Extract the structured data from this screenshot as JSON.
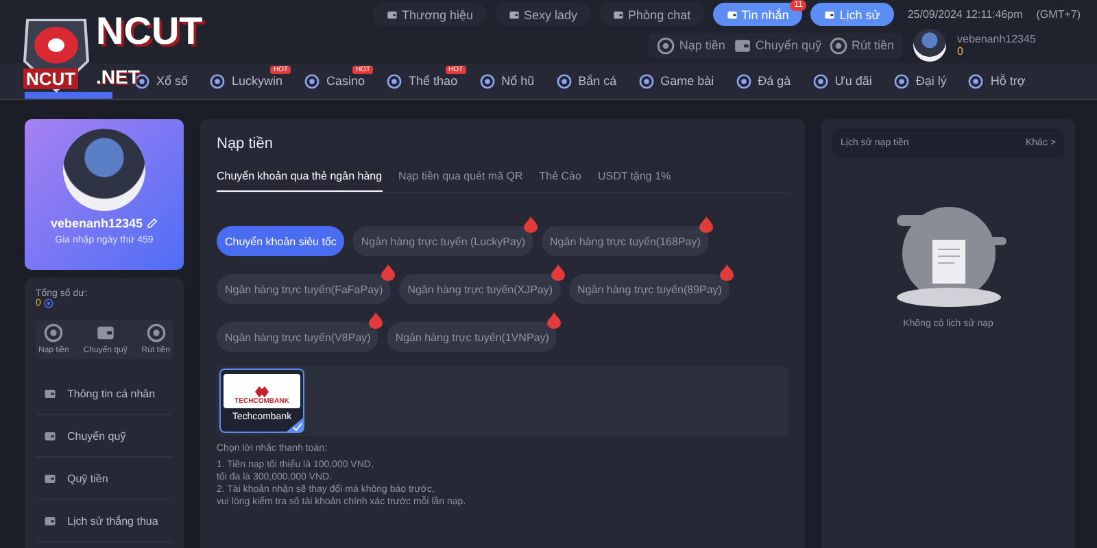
{
  "logo": {
    "brand": "NCUT",
    "badge": "NCUT",
    "domain": ".NET"
  },
  "top_links": [
    {
      "label": "Thương hiệu",
      "kind": "plain"
    },
    {
      "label": "Sexy lady",
      "kind": "plain"
    },
    {
      "label": "Phòng chat",
      "kind": "plain"
    },
    {
      "label": "Tin nhắn",
      "kind": "primary",
      "count": "11"
    },
    {
      "label": "Lịch sử",
      "kind": "primary"
    }
  ],
  "datetime": "25/09/2024 12:11:46pm",
  "timezone": "(GMT+7)",
  "wallet_actions": [
    "Nạp tiền",
    "Chuyển quỹ",
    "Rút tiền"
  ],
  "user": {
    "name": "vebenanh12345",
    "balance": "0"
  },
  "nav": [
    {
      "label": "Xổ số"
    },
    {
      "label": "Luckywin",
      "badge": "HOT"
    },
    {
      "label": "Casino",
      "badge": "HOT"
    },
    {
      "label": "Thể thao",
      "badge": "HOT"
    },
    {
      "label": "Nổ hũ"
    },
    {
      "label": "Bắn cá"
    },
    {
      "label": "Game bài"
    },
    {
      "label": "Đá gà"
    },
    {
      "label": "Ưu đãi"
    },
    {
      "label": "Đại lý"
    },
    {
      "label": "Hỗ trợ"
    }
  ],
  "profile": {
    "name": "vebenanh12345",
    "joined": "Gia nhập ngày thứ 459"
  },
  "balance": {
    "label": "Tổng số dư:",
    "value": "0",
    "actions": [
      "Nạp tiền",
      "Chuyển quỹ",
      "Rút tiền"
    ]
  },
  "menu": [
    "Thông tin cá nhân",
    "Chuyển quỹ",
    "Quỹ tiền",
    "Lịch sử thắng thua"
  ],
  "deposit": {
    "title": "Nạp tiền",
    "tabs": [
      {
        "label": "Chuyển khoản qua thẻ ngân hàng",
        "selected": true
      },
      {
        "label": "Nạp tiền qua quét mã QR",
        "selected": false
      },
      {
        "label": "Thẻ Cào",
        "selected": false
      },
      {
        "label": "USDT tặng 1%",
        "selected": false
      }
    ],
    "methods": [
      {
        "label": "Chuyển khoản siêu tốc",
        "selected": true,
        "hot": false
      },
      {
        "label": "Ngân hàng trực tuyến (LuckyPay)",
        "selected": false,
        "hot": true
      },
      {
        "label": "Ngân hàng trực tuyến(168Pay)",
        "selected": false,
        "hot": true
      },
      {
        "label": "Ngân hàng trực tuyến(FaFaPay)",
        "selected": false,
        "hot": true
      },
      {
        "label": "Ngân hàng trực tuyến(XJPay)",
        "selected": false,
        "hot": true
      },
      {
        "label": "Ngân hàng trực tuyến(89Pay)",
        "selected": false,
        "hot": true
      },
      {
        "label": "Ngân hàng trực tuyến(V8Pay)",
        "selected": false,
        "hot": true
      },
      {
        "label": "Ngân hàng trực tuyến(1VNPay)",
        "selected": false,
        "hot": true
      }
    ],
    "banks": [
      {
        "logo": "TECHCOMBANK",
        "name": "Techcombank",
        "selected": true
      }
    ],
    "notes_title": "Chọn lời nhắc thanh toán:",
    "notes": [
      "1. Tiền nạp tối thiểu là 100,000 VND,",
      "tối đa là 300,000,000 VND.",
      "2. Tài khoản nhận sẽ thay đổi mà không báo trước,",
      "vui lòng kiểm tra số tài khoản chính xác trước mỗi lần nạp."
    ]
  },
  "history": {
    "title": "Lịch sử nạp tiền",
    "more": "Khác >",
    "empty": "Không có lịch sử nạp"
  }
}
